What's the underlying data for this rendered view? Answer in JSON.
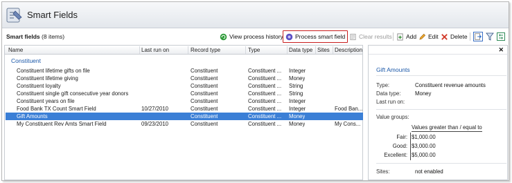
{
  "window": {
    "title": "Smart Fields"
  },
  "toolbar": {
    "heading": "Smart fields",
    "count": "(8 items)",
    "view_history": "View process history",
    "process": "Process smart field",
    "clear": "Clear results",
    "add": "Add",
    "edit": "Edit",
    "delete": "Delete"
  },
  "grid": {
    "columns": [
      "Name",
      "Last run on",
      "Record type",
      "Type",
      "Data type",
      "Sites",
      "Description"
    ],
    "group": "Constituent",
    "rows": [
      {
        "name": "Constituent lifetime gifts on file",
        "last_run": "",
        "record": "Constituent",
        "type": "Constituent ...",
        "data": "Integer",
        "sites": "",
        "desc": ""
      },
      {
        "name": "Constituent lifetime giving",
        "last_run": "",
        "record": "Constituent",
        "type": "Constituent ...",
        "data": "Money",
        "sites": "",
        "desc": ""
      },
      {
        "name": "Constituent loyalty",
        "last_run": "",
        "record": "Constituent",
        "type": "Constituent ...",
        "data": "String",
        "sites": "",
        "desc": ""
      },
      {
        "name": "Constituent single gift consecutive year donors",
        "last_run": "",
        "record": "Constituent",
        "type": "Constituent ...",
        "data": "String",
        "sites": "",
        "desc": ""
      },
      {
        "name": "Constituent years on file",
        "last_run": "",
        "record": "Constituent",
        "type": "Constituent ...",
        "data": "Integer",
        "sites": "",
        "desc": ""
      },
      {
        "name": "Food Bank TX Count Smart Field",
        "last_run": "10/27/2010",
        "record": "Constituent",
        "type": "Constituent ...",
        "data": "Integer",
        "sites": "",
        "desc": "Food Ban..."
      },
      {
        "name": "Gift Amounts",
        "last_run": "",
        "record": "Constituent",
        "type": "Constituent ...",
        "data": "Money",
        "sites": "",
        "desc": ""
      },
      {
        "name": "My Constituent Rev Amts Smart Field",
        "last_run": "09/23/2010",
        "record": "Constituent",
        "type": "Constituent ...",
        "data": "Money",
        "sites": "",
        "desc": "My Cons..."
      }
    ]
  },
  "panel": {
    "title": "Gift Amounts",
    "type_label": "Type:",
    "type_value": "Constituent revenue amounts",
    "datatype_label": "Data type:",
    "datatype_value": "Money",
    "lastrun_label": "Last run on:",
    "lastrun_value": "",
    "groups_label": "Value groups:",
    "groups_header": "Values greater than / equal to",
    "groups": [
      {
        "label": "Fair:",
        "value": "$1,000.00"
      },
      {
        "label": "Good:",
        "value": "$3,000.00"
      },
      {
        "label": "Excellent:",
        "value": "$5,000.00"
      }
    ],
    "sites_label": "Sites:",
    "sites_value": "not enabled"
  },
  "icons": [
    "app-icon",
    "refresh-icon",
    "process-icon",
    "clear-icon",
    "add-icon",
    "edit-icon",
    "delete-icon",
    "export-icon",
    "filter-icon",
    "settings-icon",
    "close-icon"
  ],
  "colors": {
    "selection": "#3b7fd6",
    "group_text": "#1a57a8",
    "highlight_border": "#c91c1c"
  }
}
